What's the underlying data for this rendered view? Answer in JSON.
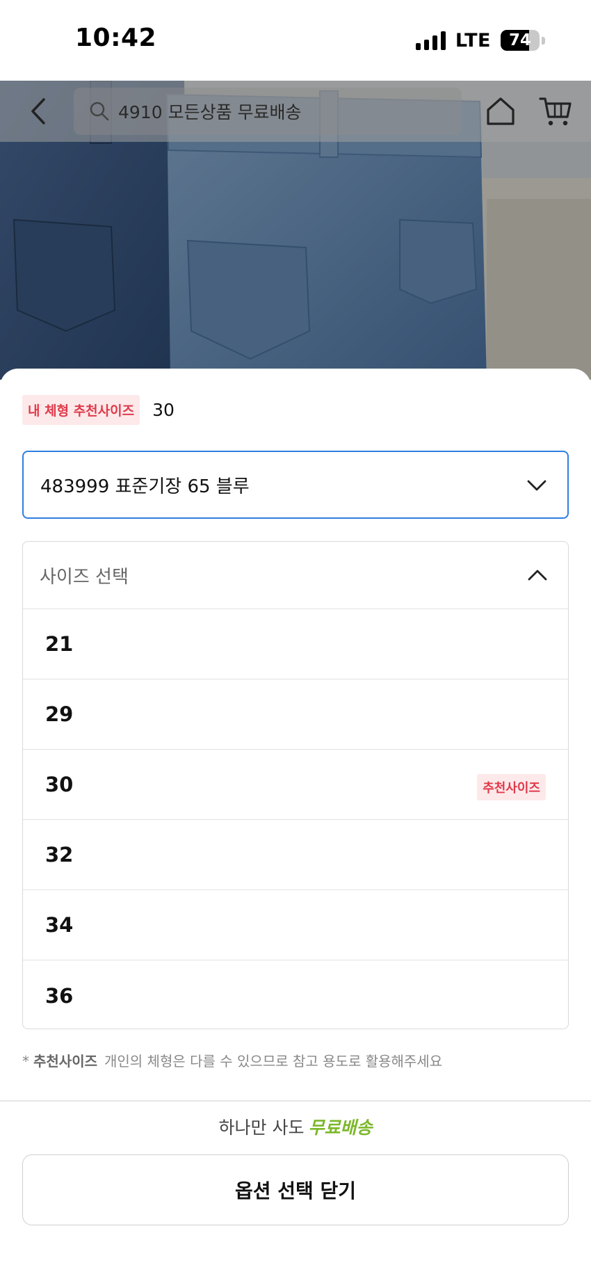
{
  "status_bar": {
    "time": "10:42",
    "network": "LTE",
    "battery": "74",
    "battery_level": 0.74
  },
  "nav": {
    "search_text": "4910 모든상품 무료배송",
    "icons": [
      "back-arrow-icon",
      "search-icon",
      "home-icon",
      "cart-icon"
    ]
  },
  "sheet": {
    "recommended_label": "내 체형 추천사이즈",
    "recommended_value": "30",
    "color_option": "483999 표준기장 65 블루",
    "size_header": "사이즈 선택",
    "sizes": [
      "21",
      "29",
      "30",
      "32",
      "34",
      "36"
    ],
    "size_recommended_badge": "추천사이즈",
    "recommended_size_index": 2,
    "note_star": "*",
    "note_strong": "추천사이즈",
    "note_text": "개인의 체형은 다를 수 있으므로 참고 용도로 활용해주세요",
    "shipping_prefix": "하나만 사도",
    "shipping_free": "무료배송",
    "close_button": "옵션 선택 닫기"
  },
  "colors": {
    "accent_blue": "#2f7de1",
    "recommend_red": "#e0394a",
    "recommend_bg": "#fde9ea",
    "free_shipping_green": "#7cb82a"
  }
}
